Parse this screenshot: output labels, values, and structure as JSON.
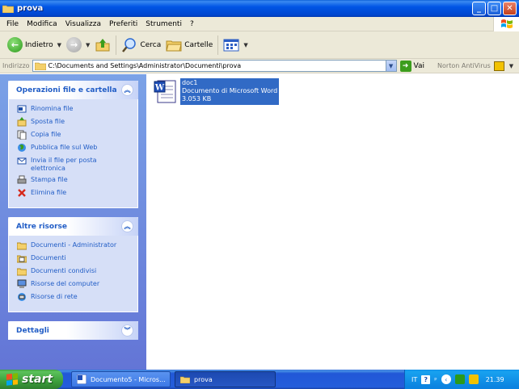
{
  "window": {
    "title": "prova",
    "buttons": {
      "minimize": "_",
      "maximize": "□",
      "close": "✕"
    }
  },
  "menu": [
    "File",
    "Modifica",
    "Visualizza",
    "Preferiti",
    "Strumenti",
    "?"
  ],
  "toolbar": {
    "back_label": "Indietro",
    "search_label": "Cerca",
    "folders_label": "Cartelle"
  },
  "address": {
    "label": "Indirizzo",
    "path": "C:\\Documents and Settings\\Administrator\\Documenti\\prova",
    "go_label": "Vai",
    "norton_label": "Norton AntiVirus"
  },
  "panels": [
    {
      "title": "Operazioni file e cartella",
      "items": [
        {
          "label": "Rinomina file",
          "icon": "rename-icon"
        },
        {
          "label": "Sposta file",
          "icon": "move-icon"
        },
        {
          "label": "Copia file",
          "icon": "copy-icon"
        },
        {
          "label": "Pubblica file sul Web",
          "icon": "globe-icon"
        },
        {
          "label": "Invia il file per posta elettronica",
          "icon": "mail-icon"
        },
        {
          "label": "Stampa file",
          "icon": "printer-icon"
        },
        {
          "label": "Elimina file",
          "icon": "delete-icon"
        }
      ]
    },
    {
      "title": "Altre risorse",
      "items": [
        {
          "label": "Documenti - Administrator",
          "icon": "folder-icon"
        },
        {
          "label": "Documenti",
          "icon": "documents-icon"
        },
        {
          "label": "Documenti condivisi",
          "icon": "shared-folder-icon"
        },
        {
          "label": "Risorse del computer",
          "icon": "computer-icon"
        },
        {
          "label": "Risorse di rete",
          "icon": "network-icon"
        }
      ]
    },
    {
      "title": "Dettagli",
      "items": []
    }
  ],
  "file": {
    "name": "doc1",
    "type": "Documento di Microsoft Word",
    "size": "3.053 KB"
  },
  "taskbar": {
    "start_label": "start",
    "tasks": [
      "Documento5 - Micros...",
      "prova"
    ],
    "language": "IT",
    "help": "?",
    "clock": "21.39"
  },
  "colors": {
    "titlebar": "#0055e5",
    "taskpane": "#7ba2e7",
    "link": "#215dc6",
    "selection": "#316ac5"
  }
}
